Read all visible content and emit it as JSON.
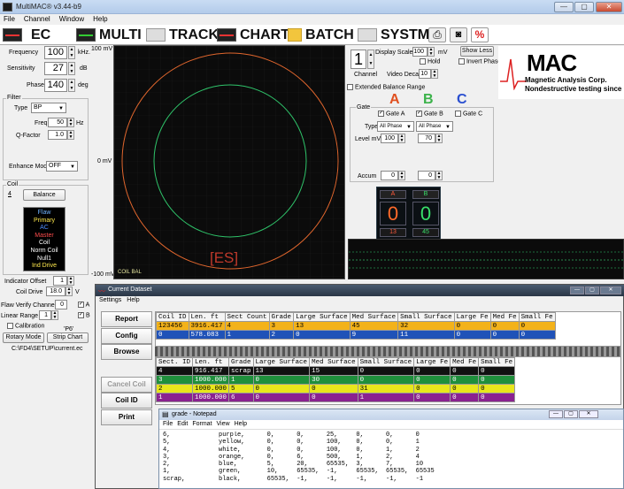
{
  "app": {
    "title": "MultiMAC® v3.44-b9",
    "window_buttons": [
      "—",
      "▢",
      "✕"
    ]
  },
  "menu": [
    "File",
    "Channel",
    "Window",
    "Help"
  ],
  "toolbar": {
    "ec": "EC",
    "multi": "MULTI",
    "track": "TRACK",
    "chart": "CHART",
    "batch": "BATCH",
    "systm": "SYSTM"
  },
  "left": {
    "frequency_label": "Frequency",
    "frequency_value": "100",
    "frequency_unit": "kHz.",
    "sensitivity_label": "Sensitivity",
    "sensitivity_value": "27",
    "sensitivity_unit": "dB",
    "phase_label": "Phase",
    "phase_value": "140",
    "phase_unit": "deg",
    "filter_label": "Filter",
    "type_label": "Type",
    "type_value": "BP",
    "freq_label": "Freq",
    "freq_value": "50",
    "freq_unit": "Hz",
    "qfactor_label": "Q-Factor",
    "qfactor_value": "1.0",
    "enhance_label": "Enhance Mode",
    "enhance_value": "OFF",
    "coil_label": "Coil",
    "coil_sub": "4",
    "balance_button": "Balance",
    "coil_list": [
      {
        "text": "Flaw",
        "color": "#6fb3ff"
      },
      {
        "text": "Primary",
        "color": "#ffe94d"
      },
      {
        "text": "AC",
        "color": "#4d8dff"
      },
      {
        "text": "Master",
        "color": "#ff4d4d"
      },
      {
        "text": "Coil",
        "color": "#ffffff"
      },
      {
        "text": "Norm Coil",
        "color": "#ffffff"
      },
      {
        "text": "Null1",
        "color": "#ffffff"
      },
      {
        "text": "Ind Drive",
        "color": "#ffe94d"
      }
    ],
    "indicator_offset_label": "Indicator Offset",
    "indicator_offset_value": "1",
    "coil_drive_label": "Coil Drive",
    "coil_drive_value": "18.0",
    "coil_drive_unit": "V",
    "flaw_verify_label": "Flaw Verify Channel",
    "flaw_verify_value": "0",
    "flaw_verify_a": "A",
    "linear_range_label": "Linear Range",
    "linear_range_value": "1",
    "linear_range_b": "B",
    "calibration_label": "Calibration",
    "calibration_code": "'P6'",
    "rotary_mode_button": "Rotary Mode",
    "strip_chart_button": "Strip Chart",
    "path": "C:\\FD4\\SETUP\\current.ec"
  },
  "scope": {
    "top_mv": "100 mV",
    "mid_mv": "0 mV",
    "bot_mv": "-100 mV",
    "label": "[ES]",
    "coil_bal": "COIL BAL"
  },
  "right": {
    "channel_value": "1",
    "channel_label": "Channel",
    "display_scale_label": "Display Scale",
    "display_scale_value": "100",
    "display_scale_unit": "mV",
    "show_less_button": "Show Less",
    "hold_label": "Hold",
    "invert_phase_label": "Invert Phase",
    "video_decay_label": "Video Decay",
    "video_decay_value": "10",
    "extended_balance_label": "Extended Balance Range",
    "gate_letters": [
      {
        "text": "A",
        "color": "#e05020"
      },
      {
        "text": "B",
        "color": "#3bb24a"
      },
      {
        "text": "C",
        "color": "#2a4fd0"
      }
    ],
    "gate_label": "Gate",
    "gate_a_label": "Gate A",
    "gate_b_label": "Gate B",
    "gate_c_label": "Gate C",
    "type_label": "Type",
    "type_a": "All Phase",
    "type_b": "All Phase",
    "level_label": "Level mV",
    "level_a": "100",
    "level_b": "70",
    "accum_label": "Accum",
    "accum_a": "0",
    "accum_b": "0",
    "counter_a_label": "A",
    "counter_b_label": "B",
    "counter_a_value": "0",
    "counter_b_value": "0",
    "counter_a_sub": "13",
    "counter_b_sub": "45"
  },
  "logo": {
    "mac": "MAC",
    "line1": "Magnetic Analysis Corp.",
    "line2": "Nondestructive testing since"
  },
  "dataset": {
    "title": "Current Dataset",
    "menu": [
      "Settings",
      "Help"
    ],
    "buttons": {
      "report": "Report",
      "config": "Config",
      "browse": "Browse",
      "cancel_coil": "Cancel Coil",
      "coil_id": "Coil ID",
      "print": "Print"
    },
    "top_headers": [
      "Coil ID",
      "Len. ft",
      "Sect Count",
      "Grade",
      "Large Surface",
      "Med Surface",
      "Small Surface",
      "Large Fe",
      "Med Fe",
      "Small Fe"
    ],
    "top_rows": [
      {
        "bg": "#f3b21a",
        "fg": "#000000",
        "cells": [
          "123456",
          "3916.417",
          "4",
          "3",
          "13",
          "45",
          "32",
          "0",
          "0",
          "0"
        ]
      },
      {
        "bg": "#1f52b8",
        "fg": "#ffffff",
        "cells": [
          "0",
          "578.083",
          "1",
          "2",
          "0",
          "9",
          "11",
          "0",
          "0",
          "0"
        ]
      }
    ],
    "bottom_headers": [
      "Sect. ID",
      "Len. ft",
      "Grade",
      "Large Surface",
      "Med Surface",
      "Small Surface",
      "Large Fe",
      "Med Fe",
      "Small Fe"
    ],
    "bottom_rows": [
      {
        "bg": "#111111",
        "fg": "#ffffff",
        "cells": [
          "4",
          "916.417",
          "scrap",
          "13",
          "15",
          "0",
          "0",
          "0",
          "0"
        ]
      },
      {
        "bg": "#1f8f3c",
        "fg": "#ffffff",
        "cells": [
          "3",
          "1000.000",
          "1",
          "0",
          "30",
          "0",
          "0",
          "0",
          "0"
        ]
      },
      {
        "bg": "#e8e61c",
        "fg": "#000000",
        "cells": [
          "2",
          "1000.000",
          "5",
          "0",
          "0",
          "31",
          "0",
          "0",
          "0"
        ]
      },
      {
        "bg": "#8a2290",
        "fg": "#ffffff",
        "cells": [
          "1",
          "1000.000",
          "6",
          "0",
          "0",
          "1",
          "0",
          "0",
          "0"
        ]
      }
    ]
  },
  "notepad": {
    "title": "grade - Notepad",
    "menu": [
      "File",
      "Edit",
      "Format",
      "View",
      "Help"
    ],
    "lines": [
      "6,             purple,      0,      0,      25,     0,      0,      0",
      "5,             yellow,      0,      0,      100,    0,      0,      1",
      "4,             white,       0,      0,      100,    0,      1,      2",
      "3,             orange,      0,      6,      500,    1,      2,      4",
      "2,             blue,        5,      20,     65535,  3,      7,      10",
      "1,             green,       10,     65535,  -1,     65535,  65535,  65535",
      "scrap,         black,       65535,  -1,     -1,     -1,     -1,     -1"
    ]
  }
}
